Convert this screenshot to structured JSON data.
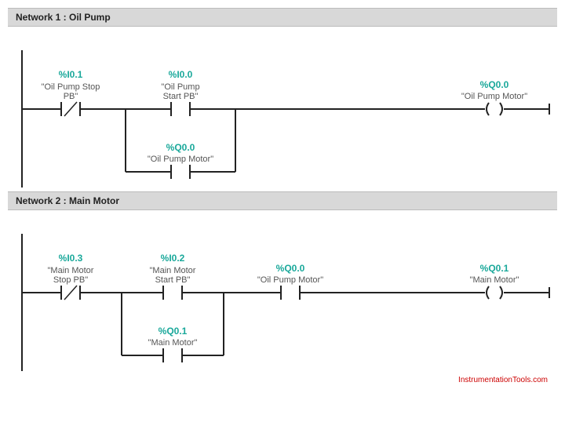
{
  "watermark": "InstrumentationTools.com",
  "networks": [
    {
      "title": "Network 1 : Oil Pump",
      "rung": [
        {
          "addr": "%I0.1",
          "desc": "\"Oil Pump Stop PB\"",
          "type": "nc"
        },
        {
          "addr": "%I0.0",
          "desc": "\"Oil Pump Start PB\"",
          "type": "no"
        },
        {
          "addr": "%Q0.0",
          "desc": "\"Oil Pump Motor\"",
          "type": "coil"
        }
      ],
      "branch": {
        "addr": "%Q0.0",
        "desc": "\"Oil Pump Motor\"",
        "type": "no"
      }
    },
    {
      "title": "Network 2 : Main Motor",
      "rung": [
        {
          "addr": "%I0.3",
          "desc": "\"Main Motor Stop PB\"",
          "type": "nc"
        },
        {
          "addr": "%I0.2",
          "desc": "\"Main Motor Start PB\"",
          "type": "no"
        },
        {
          "addr": "%Q0.0",
          "desc": "\"Oil Pump Motor\"",
          "type": "no"
        },
        {
          "addr": "%Q0.1",
          "desc": "\"Main Motor\"",
          "type": "coil"
        }
      ],
      "branch": {
        "addr": "%Q0.1",
        "desc": "\"Main Motor\"",
        "type": "no"
      }
    }
  ],
  "chart_data": [
    {
      "type": "table",
      "title": "Network 1 : Oil Pump — Ladder rung",
      "series": [
        {
          "name": "instruction_type",
          "values": [
            "NC contact",
            "NO contact",
            "Coil"
          ]
        },
        {
          "name": "address",
          "values": [
            "%I0.1",
            "%I0.0",
            "%Q0.0"
          ]
        },
        {
          "name": "description",
          "values": [
            "Oil Pump Stop PB",
            "Oil Pump Start PB",
            "Oil Pump Motor"
          ]
        }
      ],
      "branch_parallel_with_index": 1,
      "branch": {
        "instruction_type": "NO contact",
        "address": "%Q0.0",
        "description": "Oil Pump Motor"
      }
    },
    {
      "type": "table",
      "title": "Network 2 : Main Motor — Ladder rung",
      "series": [
        {
          "name": "instruction_type",
          "values": [
            "NC contact",
            "NO contact",
            "NO contact",
            "Coil"
          ]
        },
        {
          "name": "address",
          "values": [
            "%I0.3",
            "%I0.2",
            "%Q0.0",
            "%Q0.1"
          ]
        },
        {
          "name": "description",
          "values": [
            "Main Motor Stop PB",
            "Main Motor Start PB",
            "Oil Pump Motor",
            "Main Motor"
          ]
        }
      ],
      "branch_parallel_with_index": 1,
      "branch": {
        "instruction_type": "NO contact",
        "address": "%Q0.1",
        "description": "Main Motor"
      }
    }
  ]
}
